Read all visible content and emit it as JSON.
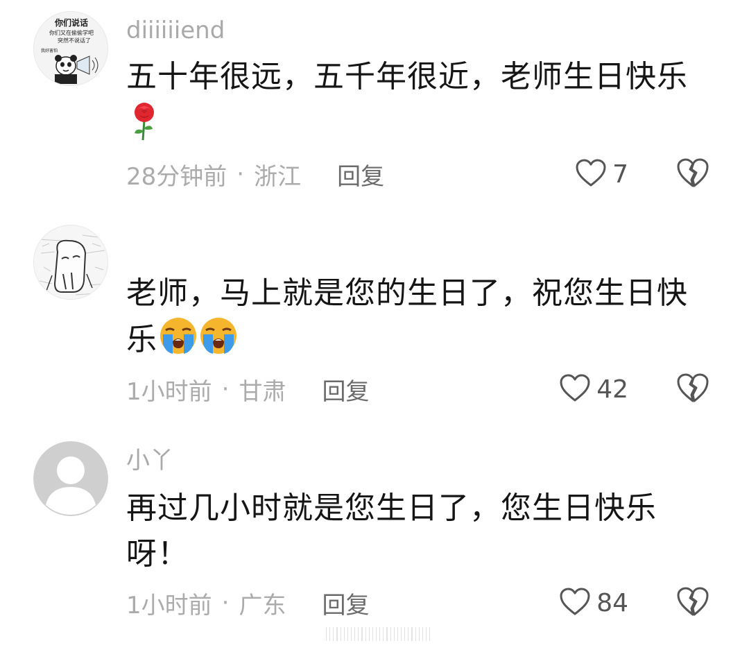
{
  "comments": [
    {
      "username": "diiiiiiend",
      "content": "五十年很远，五千年很近，老师生日快乐",
      "emojis": [
        "rose"
      ],
      "time": "28分钟前",
      "separator": "·",
      "location": "浙江",
      "reply_label": "回复",
      "like_count": "7"
    },
    {
      "username": "",
      "content": "老师，马上就是您的生日了，祝您生日快乐",
      "emojis": [
        "loudly-crying-face",
        "loudly-crying-face"
      ],
      "time": "1小时前",
      "separator": "·",
      "location": "甘肃",
      "reply_label": "回复",
      "like_count": "42"
    },
    {
      "username": "小丫",
      "content": "再过几小时就是您生日了，您生日快乐呀！",
      "emojis": [],
      "time": "1小时前",
      "separator": "·",
      "location": "广东",
      "reply_label": "回复",
      "like_count": "84"
    }
  ],
  "avatar_1_text": [
    "你们说话",
    "你们又在偷偷学吧",
    "突然不说话了",
    "我好害怕"
  ],
  "icons": {
    "like": "heart-outline-icon",
    "dislike": "broken-heart-icon"
  },
  "colors": {
    "meta_gray": "#ababab",
    "reply_gray": "#6b6b6b",
    "icon_gray": "#555555"
  }
}
